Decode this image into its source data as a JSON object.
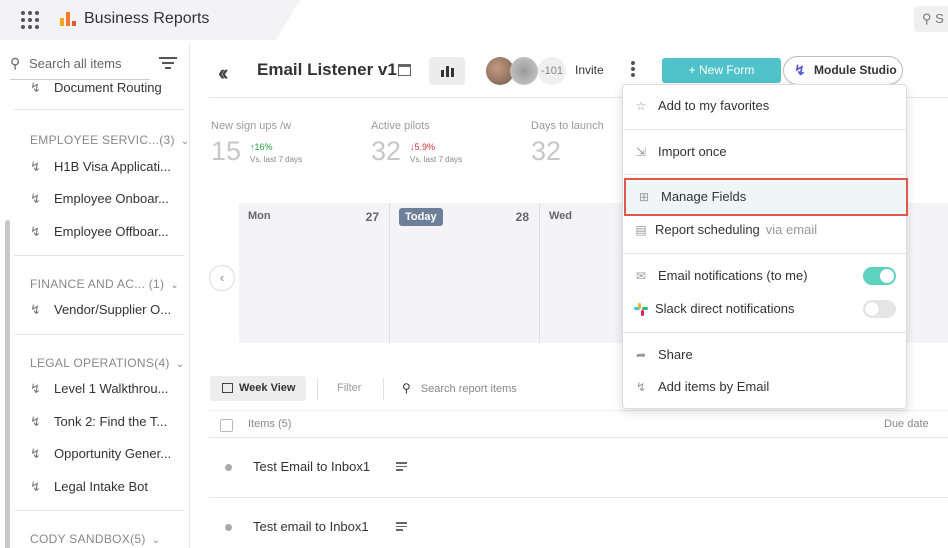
{
  "topbar": {
    "app_title": "Business Reports",
    "search_label": "S",
    "logo_colors": [
      "#f5a623",
      "#f07c2a",
      "#e8572d"
    ]
  },
  "sidebar": {
    "search_placeholder": "Search all items",
    "cut_item": "Document Routing",
    "groups": [
      {
        "label": "EMPLOYEE SERVIC...(3)",
        "items": [
          "H1B Visa Applicati...",
          "Employee Onboar...",
          "Employee Offboar..."
        ]
      },
      {
        "label": "FINANCE AND AC...  (1)",
        "items": [
          "Vendor/Supplier O..."
        ]
      },
      {
        "label": "LEGAL OPERATIONS(4)",
        "items": [
          "Level 1 Walkthrou...",
          "Tonk 2: Find the T...",
          "Opportunity Gener...",
          "Legal Intake Bot"
        ]
      },
      {
        "label": "CODY SANDBOX(5)",
        "items": []
      }
    ]
  },
  "header": {
    "title": "Email Listener v1",
    "avatar_count": "-101",
    "invite": "Invite",
    "new_form": "+ New Form",
    "module_studio": "Module Studio"
  },
  "stats": [
    {
      "label": "New sign ups /w",
      "value": "15",
      "change": "16%",
      "direction": "up",
      "sub": "Vs. last 7 days"
    },
    {
      "label": "Active pilots",
      "value": "32",
      "change": "5.9%",
      "direction": "down",
      "sub": "Vs. last 7 days"
    },
    {
      "label": "Days to launch",
      "value": "32"
    }
  ],
  "calendar": {
    "days": [
      {
        "name": "Mon",
        "date": "27"
      },
      {
        "name": "Today",
        "date": "28",
        "today": true
      },
      {
        "name": "Wed",
        "date": ""
      }
    ]
  },
  "toolbar": {
    "week_view": "Week View",
    "filter": "Filter",
    "search_placeholder": "Search report items"
  },
  "table": {
    "items_header": "Items (5)",
    "due_header": "Due date",
    "rows": [
      "Test Email to Inbox1",
      "Test email to Inbox1"
    ]
  },
  "menu": {
    "favorites": "Add to my favorites",
    "import": "Import once",
    "manage_fields": "Manage Fields",
    "report_scheduling": "Report scheduling",
    "via_email": "via email",
    "email_notifications": "Email notifications (to me)",
    "email_notifications_on": true,
    "slack_notifications": "Slack direct notifications",
    "slack_notifications_on": false,
    "share": "Share",
    "add_by_email": "Add items by Email"
  },
  "colors": {
    "accent_teal": "#4fc3c9",
    "toggle_on": "#5fd1bf",
    "highlight_border": "#e0574b",
    "module_bolt": "#5b5bd6",
    "stat_up": "#2a9d3c",
    "stat_down": "#d0333b"
  }
}
